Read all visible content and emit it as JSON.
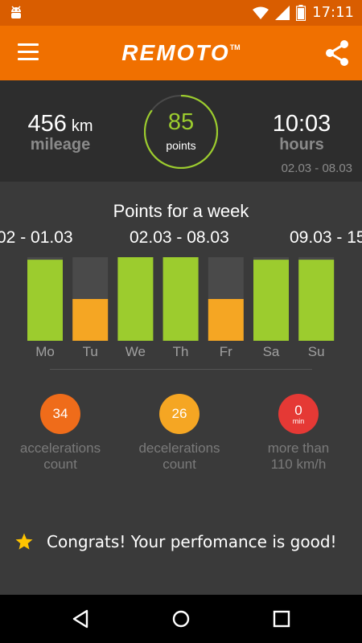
{
  "status_bar": {
    "time": "17:11"
  },
  "app_bar": {
    "logo": "REMOTO",
    "trademark": "TM"
  },
  "summary": {
    "mileage_value": "456",
    "mileage_unit": "km",
    "mileage_label": "mileage",
    "points_value": "85",
    "points_label": "points",
    "hours_value": "10:03",
    "hours_label": "hours",
    "date_range": "02.03 - 08.03"
  },
  "week": {
    "title": "Points for a week",
    "periods": {
      "prev": "02 - 01.03",
      "current": "02.03 - 08.03",
      "next": "09.03 - 15"
    }
  },
  "chart_data": {
    "type": "bar",
    "categories": [
      "Mo",
      "Tu",
      "We",
      "Th",
      "Fr",
      "Sa",
      "Su"
    ],
    "values": [
      97,
      50,
      100,
      100,
      50,
      97,
      97
    ],
    "ylim": [
      0,
      100
    ],
    "bar_colors": [
      "#9ccc2e",
      "#f5a623",
      "#9ccc2e",
      "#9ccc2e",
      "#f5a623",
      "#9ccc2e",
      "#9ccc2e"
    ],
    "track_color": "#4a4a4a"
  },
  "counters": [
    {
      "value": "34",
      "unit": "",
      "label_line1": "accelerations",
      "label_line2": "count",
      "color": "#ef6c1a"
    },
    {
      "value": "26",
      "unit": "",
      "label_line1": "decelerations",
      "label_line2": "count",
      "color": "#f5a623"
    },
    {
      "value": "0",
      "unit": "min",
      "label_line1": "more than",
      "label_line2": "110 km/h",
      "color": "#e53935"
    }
  ],
  "congrats": {
    "icon": "star-icon",
    "message": "Congrats! Your perfomance is good!"
  },
  "colors": {
    "accent": "#f07000",
    "good": "#9ccc2e",
    "medium": "#f5a623"
  }
}
